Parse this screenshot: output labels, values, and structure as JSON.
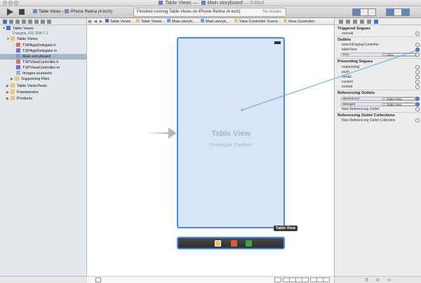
{
  "window": {
    "title_project": "Table Views",
    "title_separator": "—",
    "title_file": "Main.storyboard",
    "title_edited": "— Edited"
  },
  "toolbar": {
    "scheme_target": "Table Views",
    "scheme_separator": "›",
    "scheme_device": "iPhone Retina (4-inch)",
    "activity_text": "Finished running Table Views on iPhone Retina (4-inch)",
    "issues_text": "No Issues"
  },
  "navigator": {
    "project_name": "Table Views",
    "project_sub": "2 targets, iOS SDK 7.1",
    "group_name": "Table Views",
    "files": [
      "TSPAppDelegate.h",
      "TSPAppDelegate.m",
      "Main.storyboard",
      "TSPViewController.h",
      "TSPViewController.m",
      "Images.xcassets",
      "Supporting Files"
    ],
    "other_groups": [
      "Table ViewsTests",
      "Frameworks",
      "Products"
    ]
  },
  "jumpbar": {
    "crumbs": [
      "Table Views",
      "Table Views",
      "Main.storyb...",
      "Main.storyb...",
      "View Controller Scene",
      "View Controller"
    ],
    "separator": "›"
  },
  "canvas": {
    "table_view_title": "Table View",
    "prototype_text": "Prototype Content",
    "selection_tag": "Table View"
  },
  "inspector": {
    "triggered_title": "Triggered Segues",
    "triggered_items": [
      "manual"
    ],
    "outlets_title": "Outlets",
    "outlet_items": [
      "searchDisplayController",
      "tableView"
    ],
    "outlet_connection_left": "view",
    "outlet_connection_target": "View",
    "presenting_title": "Presenting Segues",
    "presenting_items": [
      "relationship",
      "push",
      "modal",
      "custom",
      "embed"
    ],
    "referencing_title": "Referencing Outlets",
    "referencing_connections": [
      {
        "outlet": "dataSource",
        "target": "Table View"
      },
      {
        "outlet": "delegate",
        "target": "Table View"
      }
    ],
    "new_referencing_outlet": "New Referencing Outlet",
    "collections_title": "Referencing Outlet Collections",
    "new_referencing_collection": "New Referencing Outlet Collection",
    "bottom_icons": "{} ◎ ▭"
  },
  "colors": {
    "selection_blue": "#3d8ff2",
    "connection_line": "#5ba4ec"
  }
}
